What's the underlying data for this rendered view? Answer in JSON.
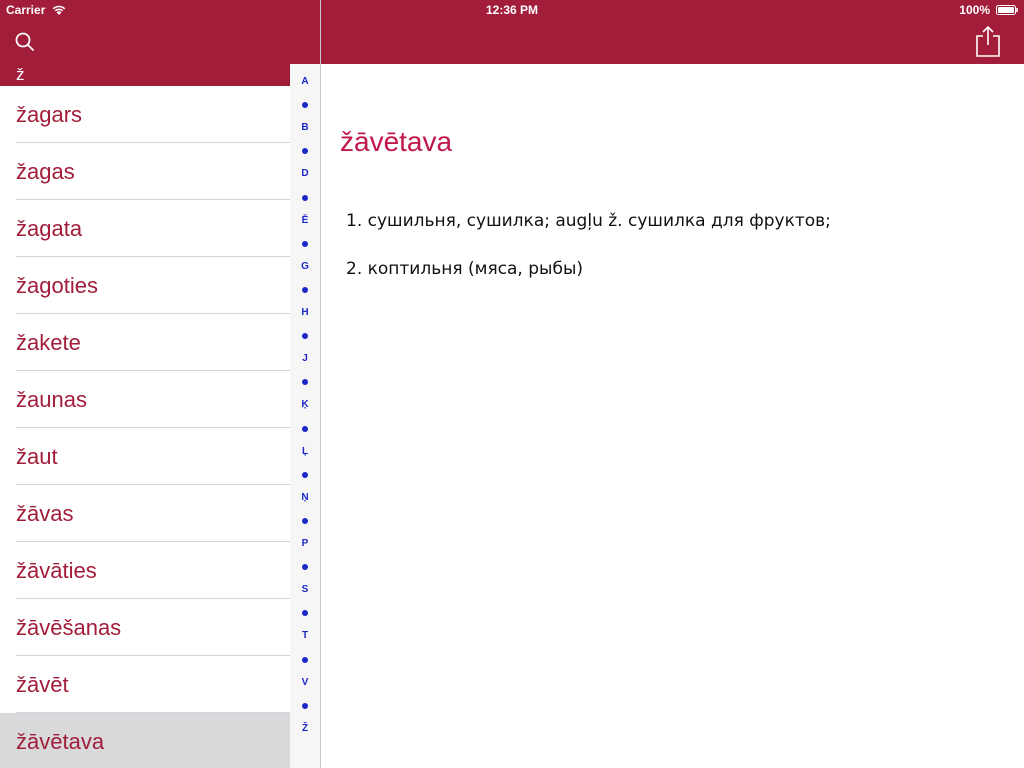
{
  "status_bar": {
    "carrier": "Carrier",
    "time": "12:36 PM",
    "battery": "100%"
  },
  "colors": {
    "header": "#a11d39",
    "accent_text": "#a11d39",
    "title_text": "#c0184a",
    "index_text": "#1c27c8",
    "selected_row": "#d9d9dc"
  },
  "toolbar": {
    "search_icon": "search-icon",
    "share_icon": "share-icon"
  },
  "list": {
    "section_letter": "ž",
    "items": [
      {
        "word": "žagars"
      },
      {
        "word": "žagas"
      },
      {
        "word": "žagata"
      },
      {
        "word": "žagoties"
      },
      {
        "word": "žakete"
      },
      {
        "word": "žaunas"
      },
      {
        "word": "žaut"
      },
      {
        "word": "žāvas"
      },
      {
        "word": "žāvāties"
      },
      {
        "word": "žāvēšanas"
      },
      {
        "word": "žāvēt"
      },
      {
        "word": "žāvētava"
      }
    ],
    "selected": "žāvētava"
  },
  "index": [
    "A",
    "B",
    "D",
    "Ē",
    "G",
    "H",
    "J",
    "Ķ",
    "Ļ",
    "Ņ",
    "P",
    "S",
    "T",
    "V",
    "Ž"
  ],
  "detail": {
    "title": "žāvētava",
    "definitions": [
      "1. сушильня, сушилка; augļu ž. сушилка для фруктов;",
      "2. коптильня (мяса, рыбы)"
    ]
  }
}
